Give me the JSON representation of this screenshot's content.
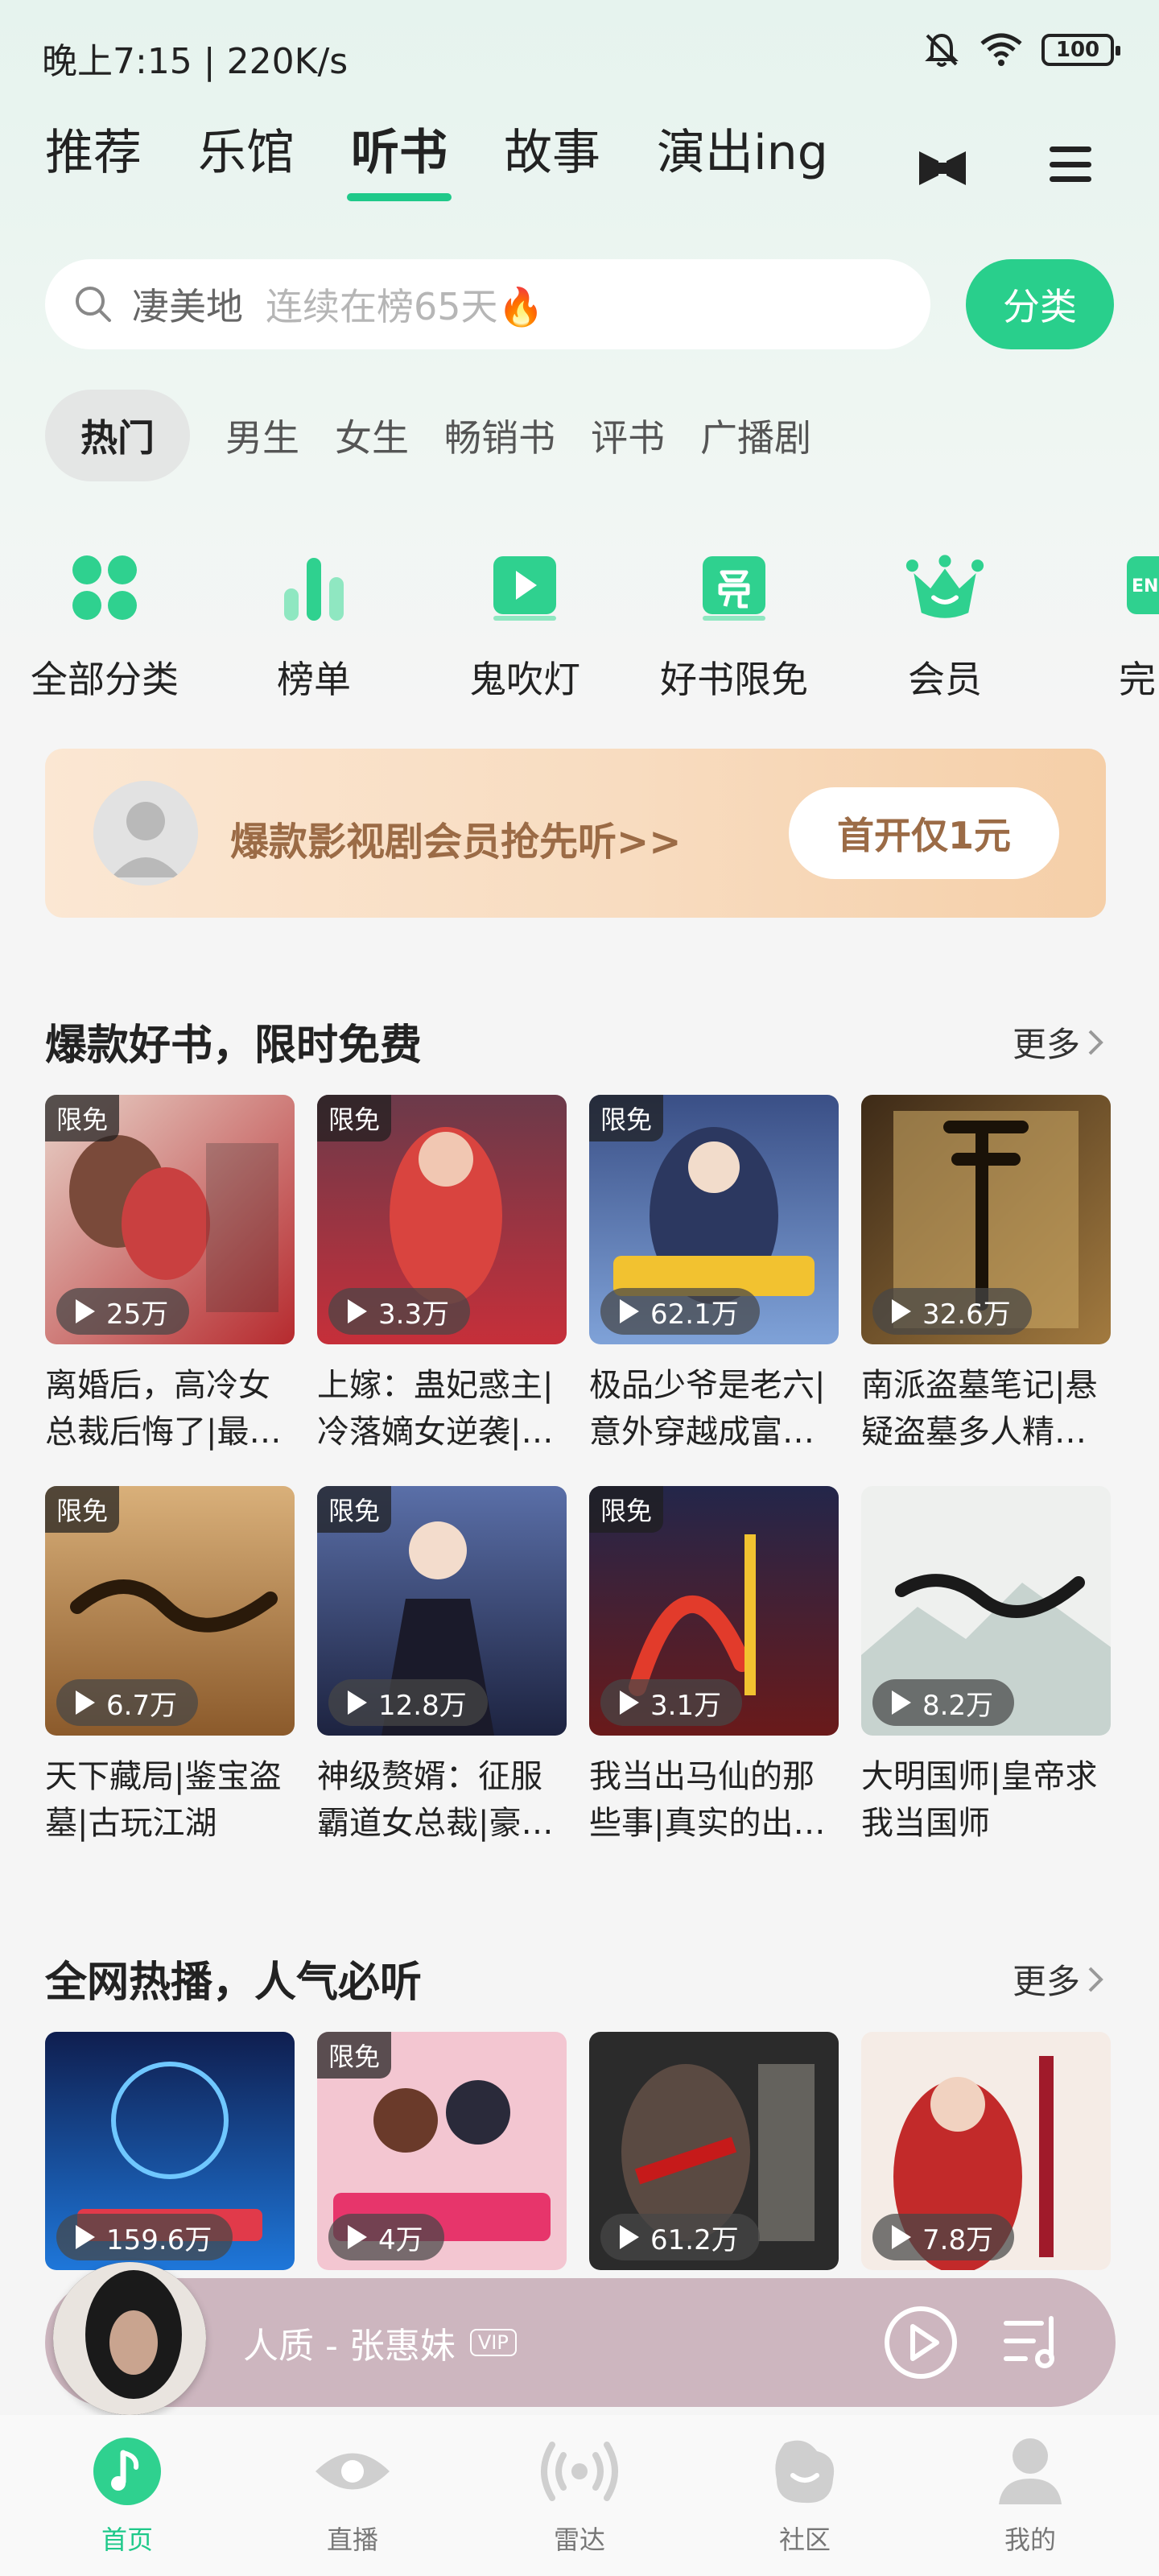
{
  "status_bar": {
    "time": "晚上7:15 | 220K/s",
    "battery": "100"
  },
  "top_tabs": [
    {
      "label": "推荐"
    },
    {
      "label": "乐馆"
    },
    {
      "label": "听书",
      "active": true
    },
    {
      "label": "故事"
    },
    {
      "label": "演出ing"
    }
  ],
  "search": {
    "keyword": "凄美地",
    "hint": "连续在榜65天🔥",
    "classify": "分类"
  },
  "sub_tabs": [
    {
      "label": "热门"
    },
    {
      "label": "男生"
    },
    {
      "label": "女生"
    },
    {
      "label": "畅销书"
    },
    {
      "label": "评书"
    },
    {
      "label": "广播剧"
    }
  ],
  "categories": [
    {
      "label": "全部分类",
      "icon": "grid-icon"
    },
    {
      "label": "榜单",
      "icon": "chart-bars-icon"
    },
    {
      "label": "鬼吹灯",
      "icon": "play-card-icon"
    },
    {
      "label": "好书限免",
      "icon": "free-icon"
    },
    {
      "label": "会员",
      "icon": "crown-icon"
    },
    {
      "label": "完",
      "icon": "en-icon"
    }
  ],
  "vip_banner": {
    "text": "爆款影视剧会员抢先听>>",
    "button": "首开仅1元"
  },
  "section1": {
    "title": "爆款好书，限时免费",
    "more": "更多",
    "books": [
      {
        "badge": "限免",
        "plays": "25万",
        "title": "离婚后，高冷女总裁后悔了|最…"
      },
      {
        "badge": "限免",
        "plays": "3.3万",
        "title": "上嫁：蛊妃惑主|冷落嫡女逆袭|…"
      },
      {
        "badge": "限免",
        "plays": "62.1万",
        "title": "极品少爷是老六|意外穿越成富…"
      },
      {
        "badge": "",
        "plays": "32.6万",
        "title": "南派盗墓笔记|悬疑盗墓多人精…"
      },
      {
        "badge": "限免",
        "plays": "6.7万",
        "title": "天下藏局|鉴宝盗墓|古玩江湖"
      },
      {
        "badge": "限免",
        "plays": "12.8万",
        "title": "神级赘婿：征服霸道女总裁|豪…"
      },
      {
        "badge": "限免",
        "plays": "3.1万",
        "title": "我当出马仙的那些事|真实的出…"
      },
      {
        "badge": "",
        "plays": "8.2万",
        "title": "大明国师|皇帝求我当国师"
      }
    ]
  },
  "section2": {
    "title": "全网热播，人气必听",
    "more": "更多",
    "books": [
      {
        "badge": "",
        "plays": "159.6万"
      },
      {
        "badge": "限免",
        "plays": "4万"
      },
      {
        "badge": "",
        "plays": "61.2万"
      },
      {
        "badge": "",
        "plays": "7.8万"
      }
    ]
  },
  "player": {
    "title": "人质 - 张惠妹",
    "vip": "VIP"
  },
  "bottom_nav": [
    {
      "label": "首页",
      "active": true
    },
    {
      "label": "直播"
    },
    {
      "label": "雷达"
    },
    {
      "label": "社区"
    },
    {
      "label": "我的"
    }
  ],
  "colors": {
    "accent": "#1fc98a",
    "banner_text": "#9b6b46",
    "player_bg": "#cdb6bf"
  }
}
